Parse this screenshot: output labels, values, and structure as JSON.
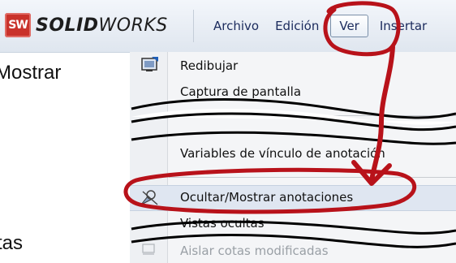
{
  "app": {
    "logo_badge": "SW",
    "logo_bold": "SOLID",
    "logo_light": "WORKS"
  },
  "menubar": {
    "items": [
      "Archivo",
      "Edición",
      "Ver",
      "Insertar"
    ],
    "active_index": 2
  },
  "background_text": {
    "top": "Mostrar",
    "bottom": "tas"
  },
  "menu": {
    "items": [
      {
        "label": "Redibujar",
        "icon": "redraw-icon"
      },
      {
        "label": "Captura de pantalla"
      },
      {
        "label": "Variables de vínculo de anotación"
      },
      {
        "label": "Ocultar/Mostrar anotaciones",
        "icon": "hide-show-annotations-icon",
        "highlighted": true
      },
      {
        "label": "Vistas ocultas"
      },
      {
        "label": "Aislar cotas modificadas",
        "icon": "isolate-dimensions-icon",
        "disabled": true
      }
    ]
  },
  "colors": {
    "annotation_red": "#b8121a",
    "logo_red": "#c9322b",
    "menu_text": "#1a2a5c"
  }
}
